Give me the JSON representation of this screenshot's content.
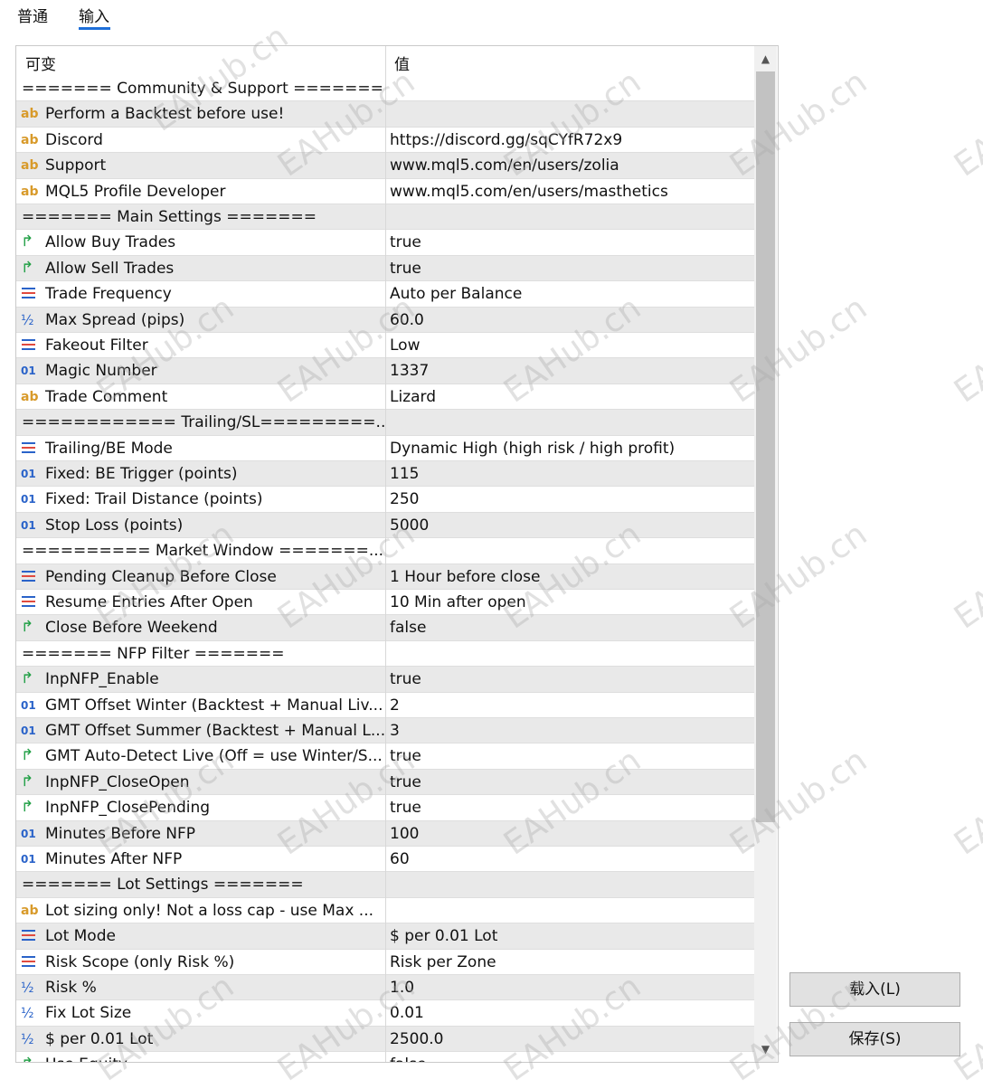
{
  "tabs": [
    "普通",
    "输入"
  ],
  "columns": {
    "variable": "可变",
    "value": "值"
  },
  "rows": [
    {
      "icon": "",
      "label": "======= Community & Support =======",
      "value": "",
      "sep": true
    },
    {
      "icon": "ab",
      "label": "Perform a Backtest before use!",
      "value": ""
    },
    {
      "icon": "ab",
      "label": "Discord",
      "value": "https://discord.gg/sqCYfR72x9"
    },
    {
      "icon": "ab",
      "label": "Support",
      "value": "www.mql5.com/en/users/zolia"
    },
    {
      "icon": "ab",
      "label": "MQL5 Profile Developer",
      "value": "www.mql5.com/en/users/masthetics"
    },
    {
      "icon": "",
      "label": "======= Main Settings =======",
      "value": "",
      "sep": true
    },
    {
      "icon": "arrow",
      "label": "Allow Buy Trades",
      "value": "true"
    },
    {
      "icon": "arrow",
      "label": "Allow Sell Trades",
      "value": "true"
    },
    {
      "icon": "enum",
      "label": "Trade Frequency",
      "value": "Auto per Balance"
    },
    {
      "icon": "half",
      "label": "Max Spread (pips)",
      "value": "60.0"
    },
    {
      "icon": "enum",
      "label": "Fakeout Filter",
      "value": "Low"
    },
    {
      "icon": "num",
      "label": "Magic Number",
      "value": "1337"
    },
    {
      "icon": "ab",
      "label": "Trade Comment",
      "value": "Lizard"
    },
    {
      "icon": "",
      "label": "============ Trailing/SL=========...",
      "value": "",
      "sep": true
    },
    {
      "icon": "enum",
      "label": "Trailing/BE Mode",
      "value": "Dynamic High (high risk / high profit)"
    },
    {
      "icon": "num",
      "label": "Fixed: BE Trigger (points)",
      "value": "115"
    },
    {
      "icon": "num",
      "label": "Fixed: Trail Distance (points)",
      "value": "250"
    },
    {
      "icon": "num",
      "label": "Stop Loss (points)",
      "value": "5000"
    },
    {
      "icon": "",
      "label": "========== Market Window =======...",
      "value": "",
      "sep": true
    },
    {
      "icon": "enum",
      "label": "Pending Cleanup Before Close",
      "value": "1 Hour before close"
    },
    {
      "icon": "enum",
      "label": "Resume Entries After Open",
      "value": "10 Min after open"
    },
    {
      "icon": "arrow",
      "label": "Close Before Weekend",
      "value": "false"
    },
    {
      "icon": "",
      "label": "======= NFP Filter =======",
      "value": "",
      "sep": true
    },
    {
      "icon": "arrow",
      "label": "InpNFP_Enable",
      "value": "true"
    },
    {
      "icon": "num",
      "label": "GMT Offset Winter (Backtest + Manual Liv...",
      "value": "2"
    },
    {
      "icon": "num",
      "label": "GMT Offset Summer (Backtest + Manual L...",
      "value": "3"
    },
    {
      "icon": "arrow",
      "label": "GMT Auto-Detect Live (Off = use Winter/S...",
      "value": "true"
    },
    {
      "icon": "arrow",
      "label": "InpNFP_CloseOpen",
      "value": "true"
    },
    {
      "icon": "arrow",
      "label": "InpNFP_ClosePending",
      "value": "true"
    },
    {
      "icon": "num",
      "label": "Minutes Before NFP",
      "value": "100"
    },
    {
      "icon": "num",
      "label": "Minutes After NFP",
      "value": "60"
    },
    {
      "icon": "",
      "label": "======= Lot Settings =======",
      "value": "",
      "sep": true
    },
    {
      "icon": "ab",
      "label": "Lot sizing only! Not a loss cap - use Max ...",
      "value": ""
    },
    {
      "icon": "enum",
      "label": "Lot Mode",
      "value": "$ per 0.01 Lot"
    },
    {
      "icon": "enum",
      "label": "Risk Scope (only Risk %)",
      "value": "Risk per Zone"
    },
    {
      "icon": "half",
      "label": "Risk %",
      "value": "1.0"
    },
    {
      "icon": "half",
      "label": "Fix Lot Size",
      "value": "0.01"
    },
    {
      "icon": "half",
      "label": "$ per 0.01 Lot",
      "value": "2500.0"
    },
    {
      "icon": "arrow",
      "label": "Use Equity",
      "value": "false"
    }
  ],
  "buttons": {
    "load": "载入(L)",
    "save": "保存(S)"
  },
  "watermark": "EAHub.cn"
}
